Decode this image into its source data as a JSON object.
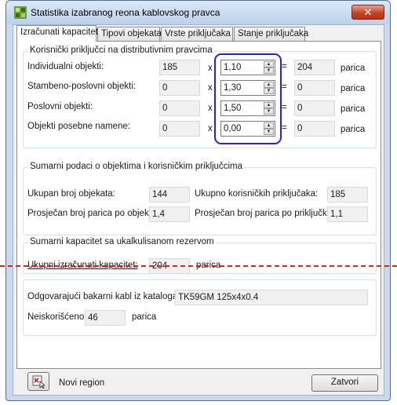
{
  "window": {
    "title": "Statistika izabranog reona kablovskog pravca",
    "close_glyph": "✕",
    "icon": "app-icon"
  },
  "tabs": [
    {
      "label": "Izračunati kapacitet",
      "active": true
    },
    {
      "label": "Tipovi objekata",
      "active": false
    },
    {
      "label": "Vrste priključaka",
      "active": false
    },
    {
      "label": "Stanje priključaka",
      "active": false
    }
  ],
  "users_group": {
    "title": "Korisnički priključci na distributivnim pravcima",
    "times": "x",
    "equals": "=",
    "unit": "parica",
    "rows": [
      {
        "label": "Individualni objekti:",
        "count": "185",
        "factor": "1,10",
        "result": "204"
      },
      {
        "label": "Stambeno-poslovni objekti:",
        "count": "0",
        "factor": "1,30",
        "result": "0"
      },
      {
        "label": "Poslovni objekti:",
        "count": "0",
        "factor": "1,50",
        "result": "0"
      },
      {
        "label": "Objekti posebne namene:",
        "count": "0",
        "factor": "0,00",
        "result": "0"
      }
    ]
  },
  "summary_group": {
    "title": "Sumarni podaci o objektima i korisničkim priključcima",
    "total_objects_label": "Ukupan broj objekata:",
    "total_objects_value": "144",
    "total_connections_label": "Ukupno korisničkih priključaka:",
    "total_connections_value": "185",
    "avg_per_object_label": "Prosječan broj parica po objektu",
    "avg_per_object_value": "1,4",
    "avg_per_connection_label": "Prosječan broj parica po priključku",
    "avg_per_connection_value": "1,1"
  },
  "capacity_group": {
    "title": "Sumarni kapacitet sa ukalkulisanom rezervom",
    "total_label": "Ukupni izračunati kapacitet:",
    "total_value": "204",
    "unit": "parica"
  },
  "cable": {
    "label": "Odgovarajući bakarni kabl iz kataloga:",
    "value": "TK59GM 125x4x0.4",
    "unused_label": "Neiskorišćeno",
    "unused_value": "46",
    "unit": "parica"
  },
  "footer": {
    "new_region_label": "Novi region",
    "close_label": "Zatvori"
  },
  "annotation": {
    "dashed_line_color": "#d9241c",
    "highlight_color": "#2323d9"
  }
}
